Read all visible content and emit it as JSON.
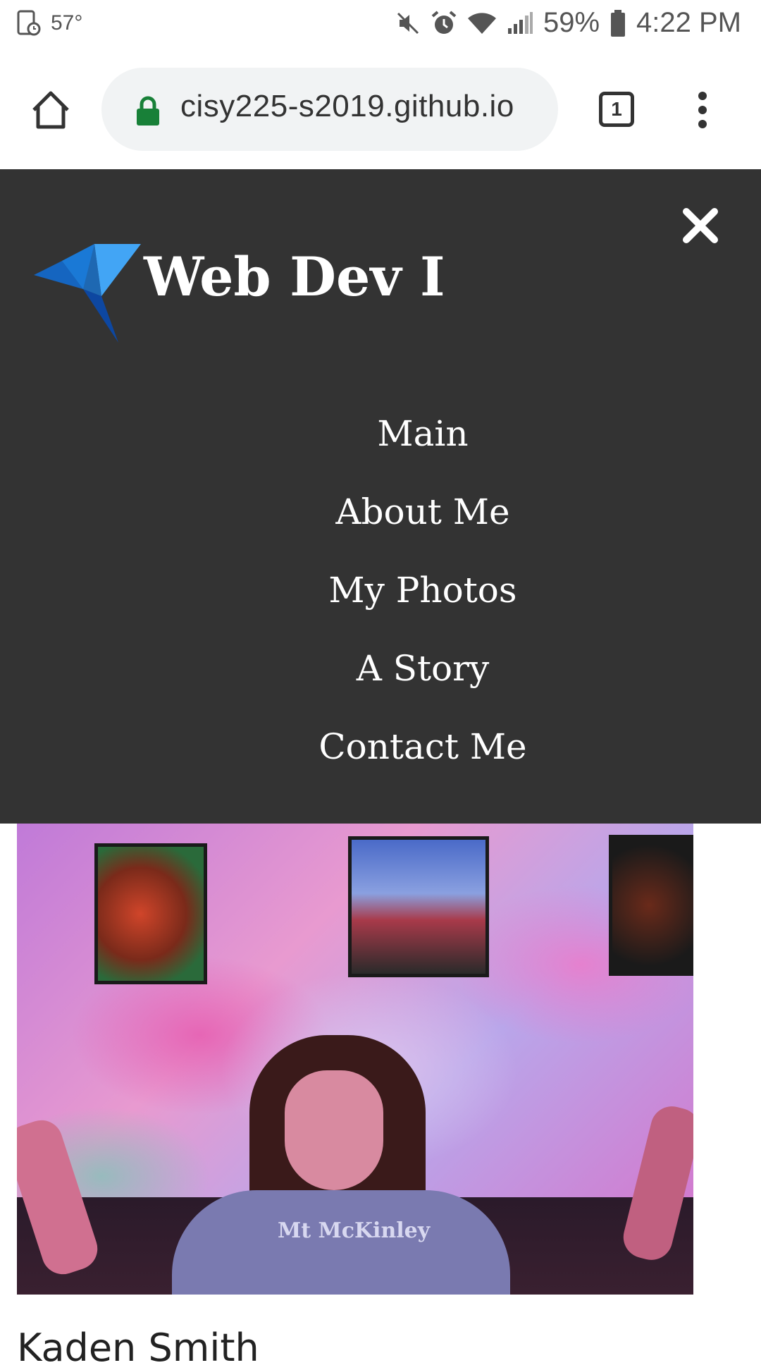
{
  "status_bar": {
    "temperature": "57°",
    "battery": "59%",
    "time": "4:22 PM"
  },
  "browser": {
    "url": "cisy225-s2019.github.io",
    "tab_count": "1"
  },
  "nav": {
    "site_title": "Web Dev I",
    "items": [
      {
        "label": "Main"
      },
      {
        "label": "About Me"
      },
      {
        "label": "My Photos"
      },
      {
        "label": "A Story"
      },
      {
        "label": "Contact Me"
      }
    ]
  },
  "hero": {
    "shirt_text": "Mt McKinley"
  },
  "content": {
    "heading_partial": "Kaden Smith"
  },
  "colors": {
    "overlay_bg": "#333333",
    "lock_green": "#188038",
    "logo_blue": "#1e88e5"
  }
}
